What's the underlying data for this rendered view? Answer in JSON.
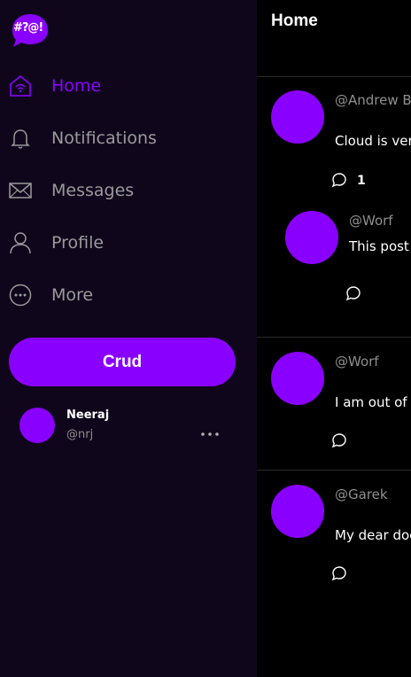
{
  "app": {
    "logo_text": "#?@!"
  },
  "sidebar": {
    "items": [
      {
        "label": "Home",
        "icon": "home-icon"
      },
      {
        "label": "Notifications",
        "icon": "bell-icon"
      },
      {
        "label": "Messages",
        "icon": "mail-icon"
      },
      {
        "label": "Profile",
        "icon": "person-icon"
      },
      {
        "label": "More",
        "icon": "more-circle-icon"
      }
    ],
    "crud_label": "Crud",
    "user": {
      "name": "Neeraj",
      "handle": "@nrj"
    }
  },
  "main": {
    "title": "Home",
    "posts": [
      {
        "handle": "@Andrew Br",
        "text": "Cloud is very",
        "comment_count": "1"
      },
      {
        "handle": "@Worf",
        "text": "This post l",
        "comment_count": ""
      },
      {
        "handle": "@Worf",
        "text": "I am out of p",
        "comment_count": ""
      },
      {
        "handle": "@Garek",
        "text": "My dear doc",
        "comment_count": ""
      }
    ]
  },
  "colors": {
    "accent": "#8a00ff",
    "sidebar_bg": "#10061c",
    "main_bg": "#000000"
  }
}
